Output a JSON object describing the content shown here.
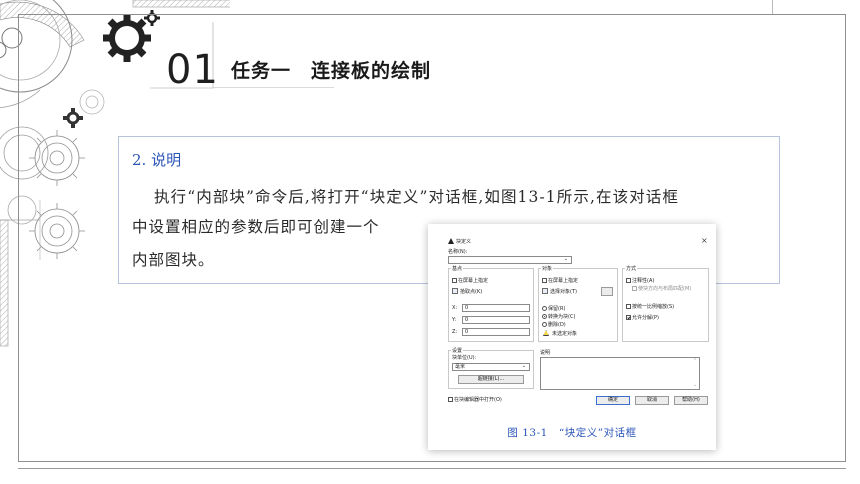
{
  "header": {
    "number": "01",
    "title": "任务一　连接板的绘制"
  },
  "content": {
    "section_heading": "2. 说明",
    "line1": "执行“内部块”命令后,将打开“块定义”对话框,如图13-1所示,在该对话框",
    "line2": "中设置相应的参数后即可创建一个",
    "line3": "内部图块。"
  },
  "dialog": {
    "title": "块定义",
    "close_symbol": "×",
    "name_label": "名称(N):",
    "name_value": "",
    "groups": {
      "base_point": "基点",
      "objects": "对象",
      "behavior": "方式",
      "settings": "设置",
      "description": "说明"
    },
    "base_point": {
      "specify_on_screen": "在屏幕上指定",
      "pick_point": "拾取点(K)",
      "x_label": "X:",
      "y_label": "Y:",
      "z_label": "Z:",
      "x_value": "0",
      "y_value": "0",
      "z_value": "0"
    },
    "objects": {
      "specify_on_screen": "在屏幕上指定",
      "select_objects": "选择对象(T)",
      "retain": "保留(R)",
      "convert_to_block": "转换为块(C)",
      "delete": "删除(D)",
      "no_selection": "未选定对象"
    },
    "behavior": {
      "annotative": "注释性(A)",
      "match_orientation": "使块方向与布局匹配(M)",
      "scale_uniformly": "按统一比例缩放(S)",
      "allow_exploding": "允许分解(P)"
    },
    "settings": {
      "block_unit_label": "块单位(U):",
      "block_unit_value": "毫米",
      "hyperlink": "超链接(L)..."
    },
    "footer": {
      "open_in_editor": "在块编辑器中打开(O)",
      "ok": "确定",
      "cancel": "取消",
      "help": "帮助(H)"
    }
  },
  "figure_caption": "图 13-1　“块定义”对话框",
  "colors": {
    "accent_blue": "#2b55b8",
    "panel_border": "#b7c3dd",
    "frame_gray": "#8e8e8e"
  }
}
